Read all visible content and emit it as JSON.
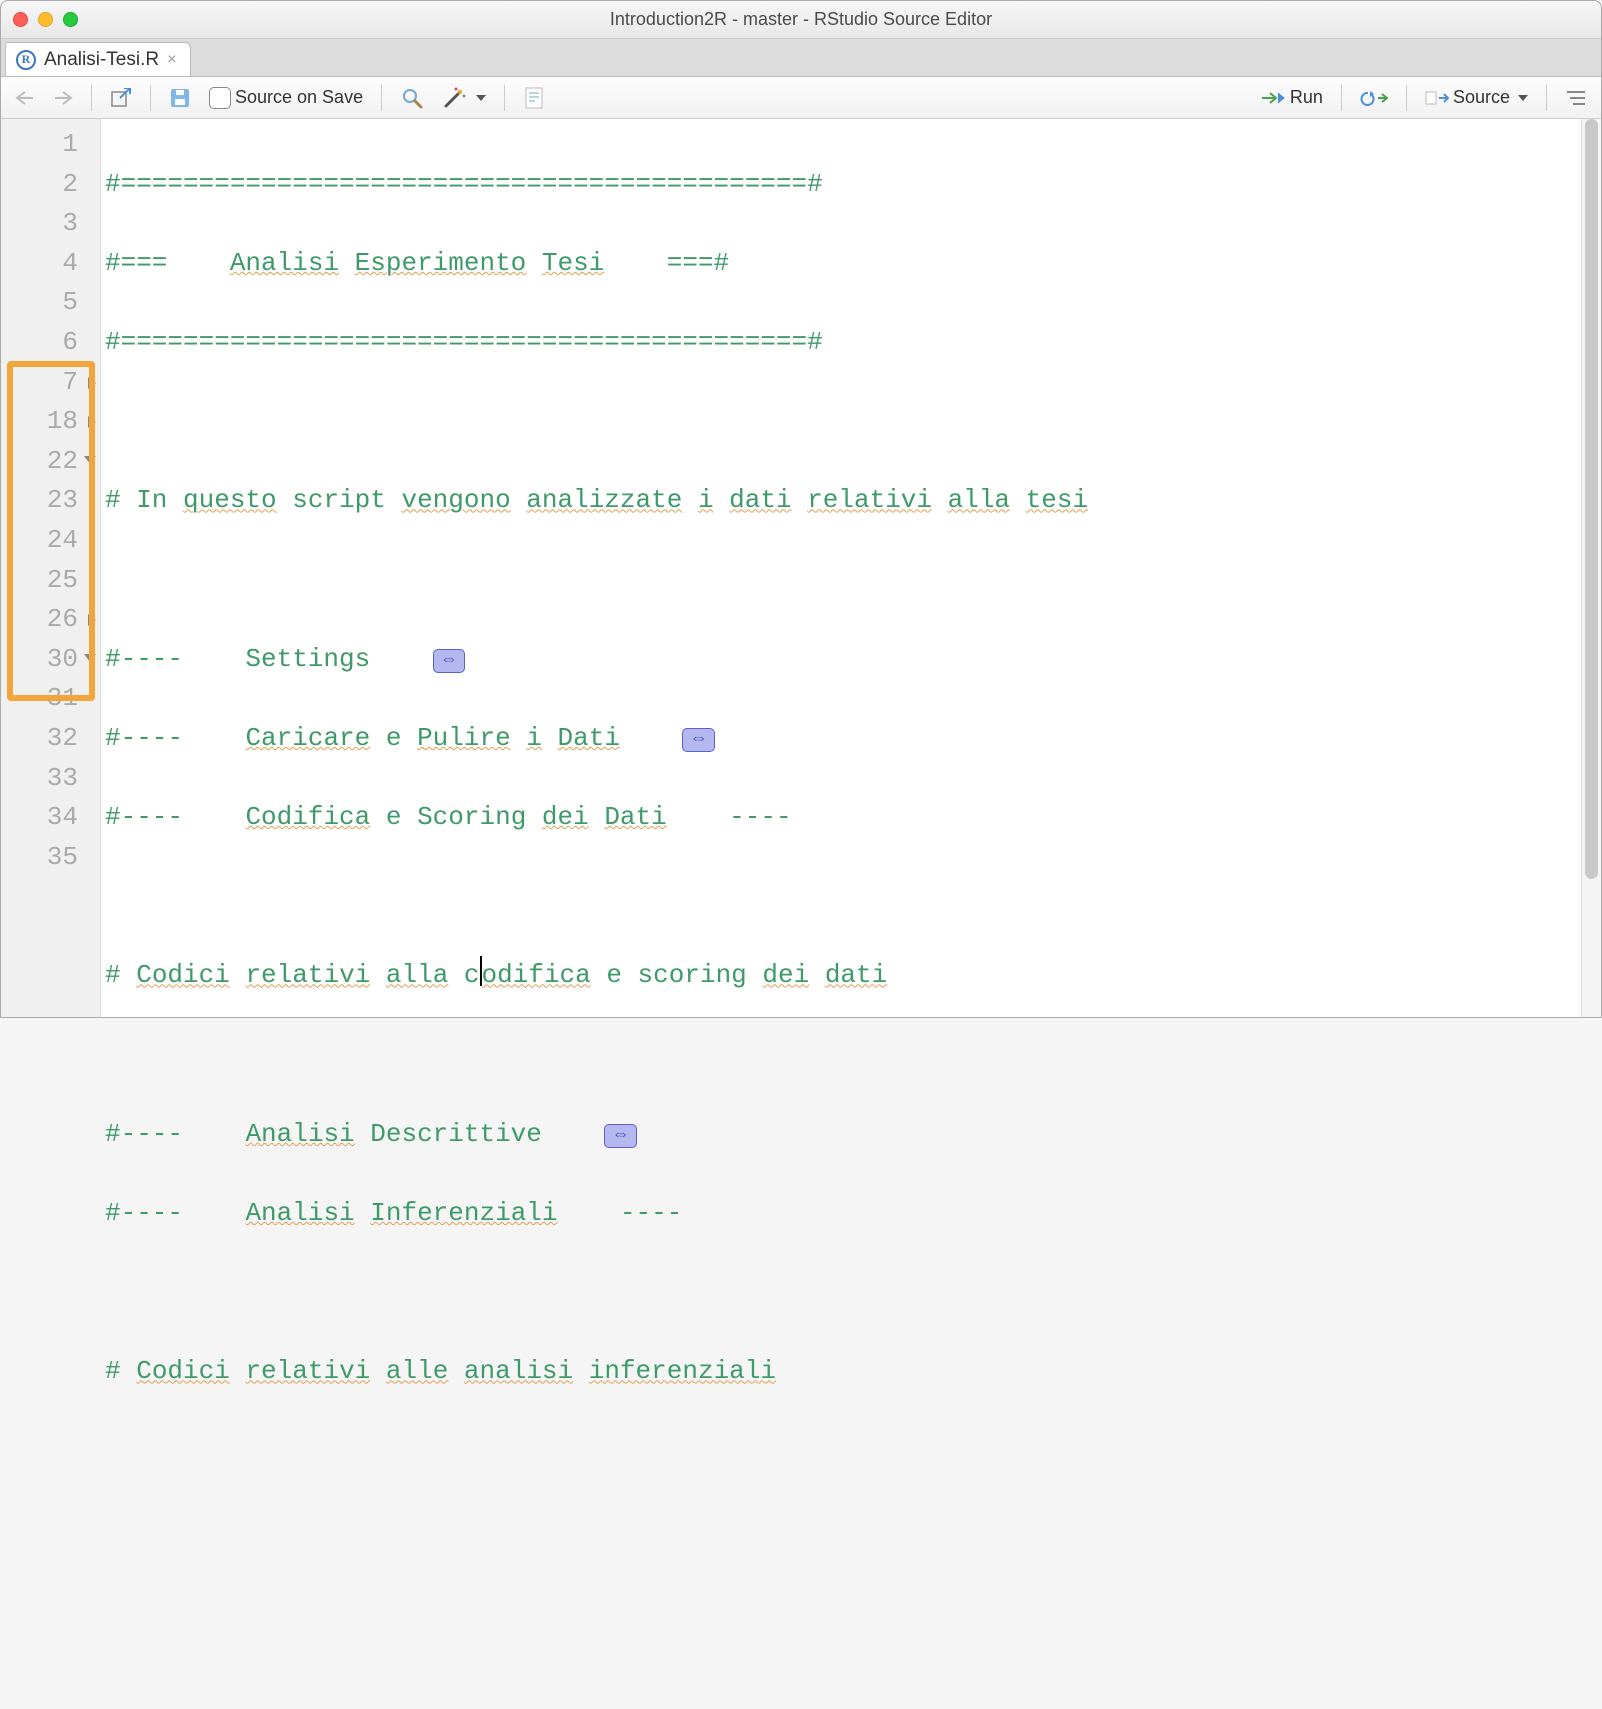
{
  "window": {
    "title": "Introduction2R - master - RStudio Source Editor"
  },
  "tab": {
    "filename": "Analisi-Tesi.R"
  },
  "toolbar": {
    "source_on_save": "Source on Save",
    "run": "Run",
    "source": "Source"
  },
  "gutter": {
    "lines": [
      "1",
      "2",
      "3",
      "4",
      "5",
      "6",
      "7",
      "18",
      "22",
      "23",
      "24",
      "25",
      "26",
      "30",
      "31",
      "32",
      "33",
      "34",
      "35"
    ],
    "folds": {
      "6": "closed",
      "7": "closed",
      "8": "open",
      "12": "closed",
      "13": "open"
    }
  },
  "code": {
    "l1": "#============================================#",
    "l2a": "#===    ",
    "l2b": "Analisi",
    "l2c": " ",
    "l2d": "Esperimento",
    "l2e": " ",
    "l2f": "Tesi",
    "l2g": "    ===#",
    "l3": "#============================================#",
    "l5a": "# In ",
    "l5b": "questo",
    "l5c": " script ",
    "l5d": "vengono",
    "l5e": " ",
    "l5f": "analizzate",
    "l5g": " ",
    "l5h": "i",
    "l5i": " ",
    "l5j": "dati",
    "l5k": " ",
    "l5l": "relativi",
    "l5m": " ",
    "l5n": "alla",
    "l5o": " ",
    "l5p": "tesi",
    "l7a": "#----    Settings    ",
    "l18a": "#----    ",
    "l18b": "Caricare",
    "l18c": " e ",
    "l18d": "Pulire",
    "l18e": " ",
    "l18f": "i",
    "l18g": " ",
    "l18h": "Dati",
    "l18i": "    ",
    "l22a": "#----    ",
    "l22b": "Codifica",
    "l22c": " e Scoring ",
    "l22d": "dei",
    "l22e": " ",
    "l22f": "Dati",
    "l22g": "    ----",
    "l24a": "# ",
    "l24b": "Codici",
    "l24c": " ",
    "l24d": "relativi",
    "l24e": " ",
    "l24f": "alla",
    "l24g": " c",
    "l24h": "odifica",
    "l24i": " e scoring ",
    "l24j": "dei",
    "l24k": " ",
    "l24l": "dati",
    "l26a": "#----    ",
    "l26b": "Analisi",
    "l26c": " Descrittive    ",
    "l30a": "#----    ",
    "l30b": "Analisi",
    "l30c": " ",
    "l30d": "Inferenziali",
    "l30e": "    ----",
    "l32a": "# ",
    "l32b": "Codici",
    "l32c": " ",
    "l32d": "relativi",
    "l32e": " ",
    "l32f": "alle",
    "l32g": " ",
    "l32h": "analisi",
    "l32i": " ",
    "l32j": "inferenziali",
    "foldglyph": "⇔"
  }
}
